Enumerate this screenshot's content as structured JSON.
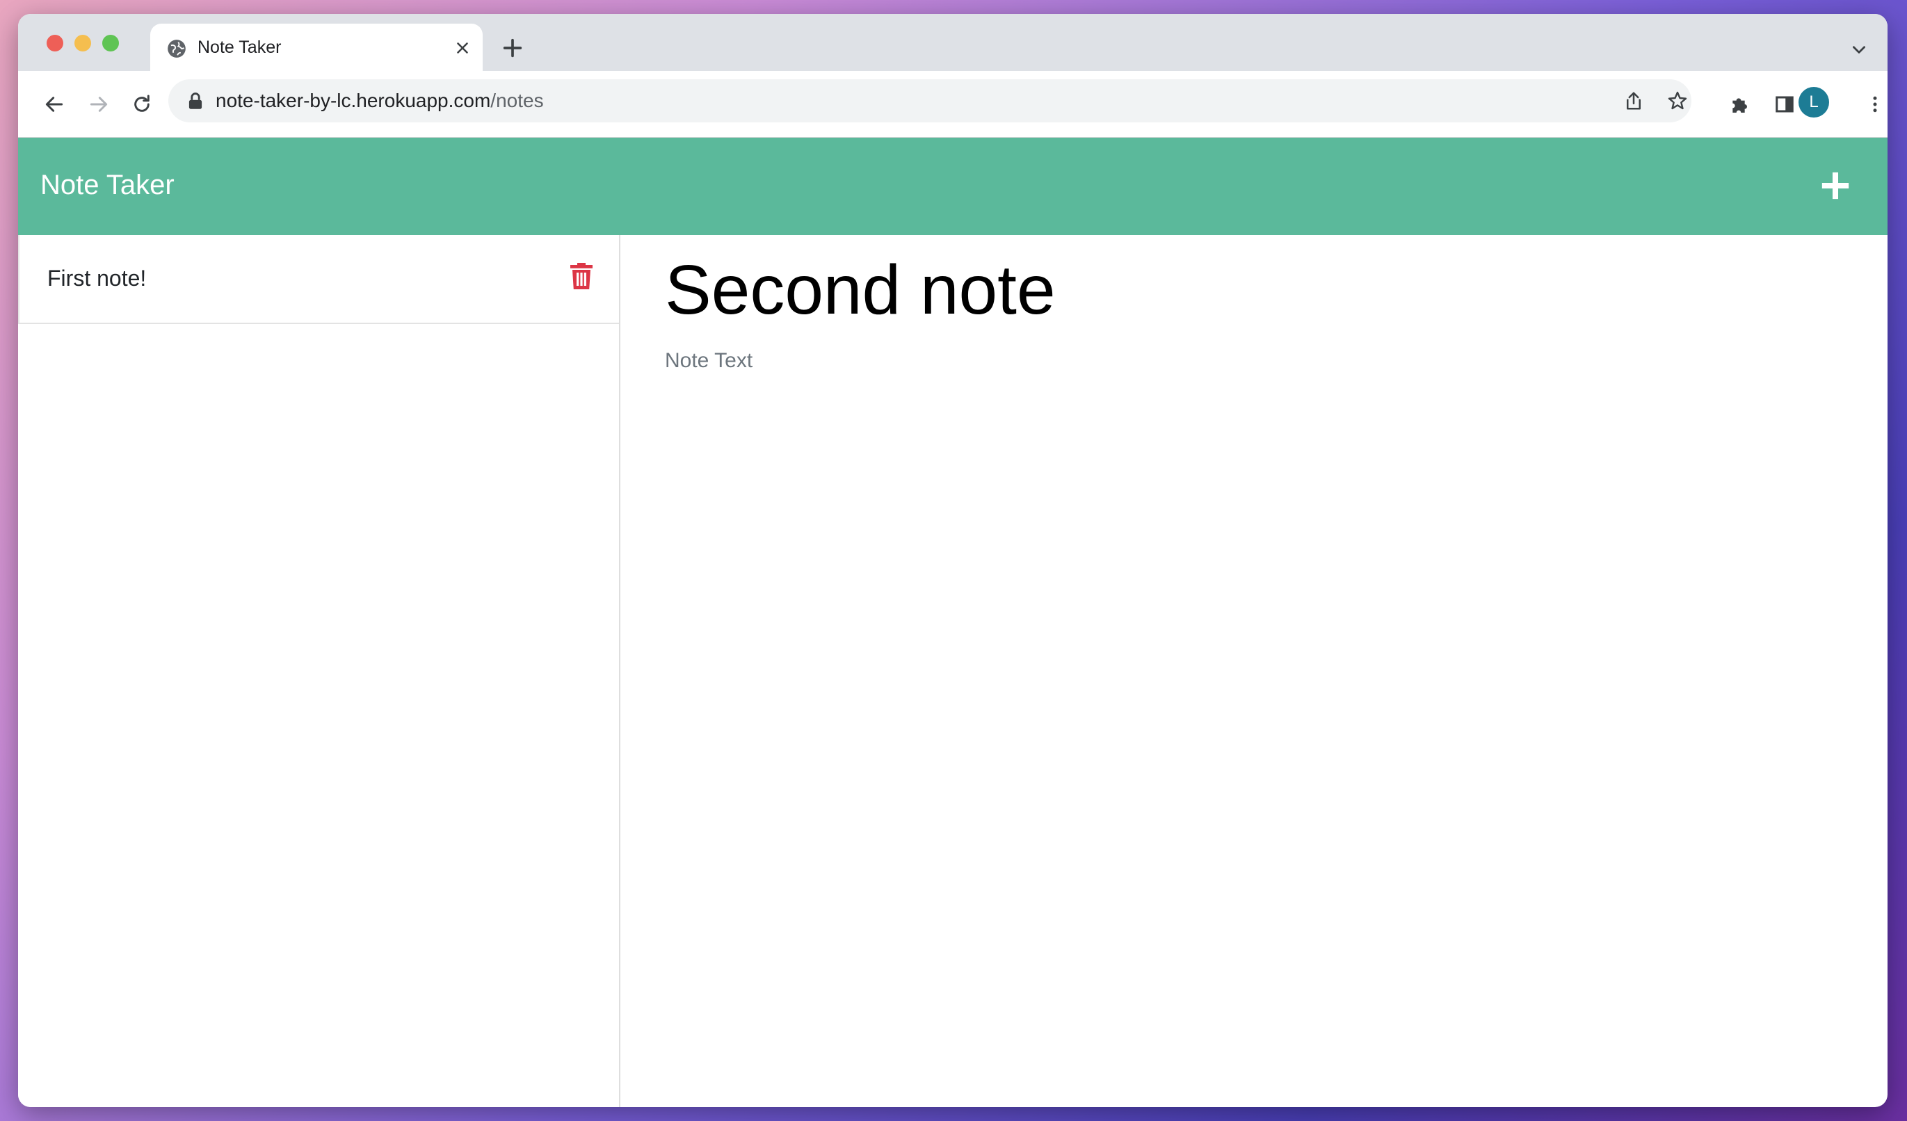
{
  "browser": {
    "tab_title": "Note Taker",
    "url_host": "note-taker-by-lc.herokuapp.com",
    "url_path": "/notes",
    "profile_initial": "L"
  },
  "app": {
    "brand": "Note Taker",
    "add_icon": "plus-icon"
  },
  "sidebar": {
    "notes": [
      {
        "title": "First note!",
        "delete_icon": "trash-icon",
        "delete_color": "#dc3545"
      }
    ]
  },
  "main": {
    "note_title": "Second note",
    "note_text": "Note Text"
  },
  "colors": {
    "appbar": "#5bb99b",
    "avatar": "#1d7c95"
  }
}
